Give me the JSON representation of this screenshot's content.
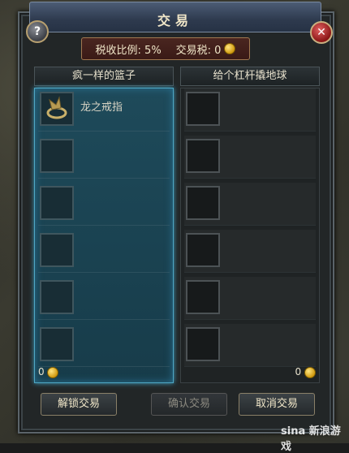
{
  "window": {
    "title": "交易"
  },
  "header": {
    "tax_rate_label": "税收比例: 5%",
    "trade_tax_label": "交易税: 0"
  },
  "left_player": {
    "name": "疯一样的篮子",
    "items": [
      {
        "name": "龙之戒指"
      },
      {
        "name": ""
      },
      {
        "name": ""
      },
      {
        "name": ""
      },
      {
        "name": ""
      },
      {
        "name": ""
      }
    ],
    "gold": "0"
  },
  "right_player": {
    "name": "给个杠杆撬地球",
    "items": [
      {
        "name": ""
      },
      {
        "name": ""
      },
      {
        "name": ""
      },
      {
        "name": ""
      },
      {
        "name": ""
      },
      {
        "name": ""
      }
    ],
    "gold": "0"
  },
  "buttons": {
    "unlock": "解锁交易",
    "confirm": "确认交易",
    "cancel": "取消交易"
  },
  "watermark": "sina 新浪游戏",
  "colors": {
    "accent_blue": "#4fa7c4",
    "gold": "#d19a10",
    "close_red": "#8a1515"
  }
}
